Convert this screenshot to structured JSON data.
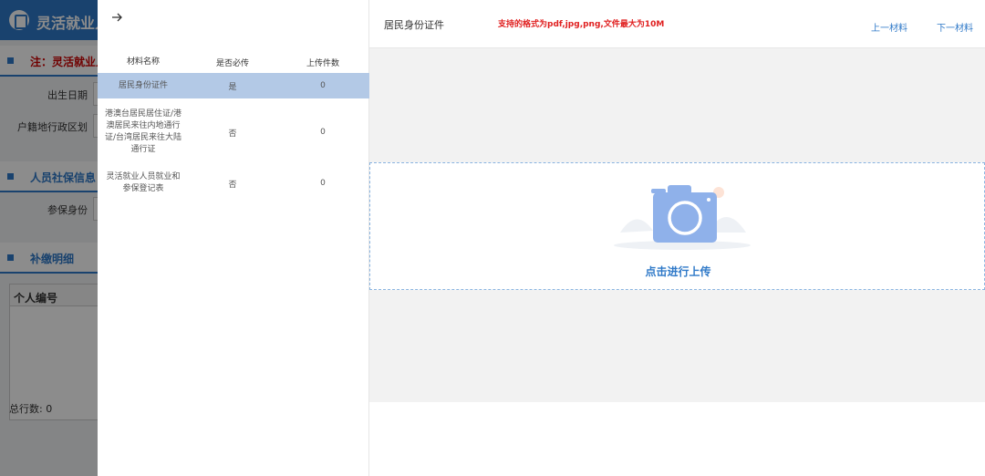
{
  "background": {
    "app_title": "灵活就业人",
    "sections": [
      {
        "label": "注：灵活就业人"
      },
      {
        "label": "人员社保信息"
      },
      {
        "label": "补缴明细"
      }
    ],
    "fields": [
      {
        "label": "出生日期"
      },
      {
        "label": "户籍地行政区划"
      },
      {
        "label": "参保身份"
      }
    ],
    "table_header": "个人编号",
    "total_label": "总行数:  0"
  },
  "drawer": {
    "materials_table": {
      "columns": [
        "材料名称",
        "是否必传",
        "上传件数"
      ],
      "rows": [
        {
          "name": "居民身份证件",
          "required": "是",
          "count": "0"
        },
        {
          "name": "港澳台居民居住证/港澳居民来往内地通行证/台湾居民来往大陆通行证",
          "required": "否",
          "count": "0"
        },
        {
          "name": "灵活就业人员就业和参保登记表",
          "required": "否",
          "count": "0"
        }
      ]
    },
    "viewer": {
      "title": "居民身份证件",
      "hint": "支持的格式为pdf,jpg,png,文件最大为10M",
      "prev_label": "上一材料",
      "next_label": "下一材料",
      "upload_label": "点击进行上传"
    }
  },
  "colors": {
    "accent": "#2f79c8",
    "hint": "#e02020",
    "selected_row": "#b3c9e6"
  }
}
